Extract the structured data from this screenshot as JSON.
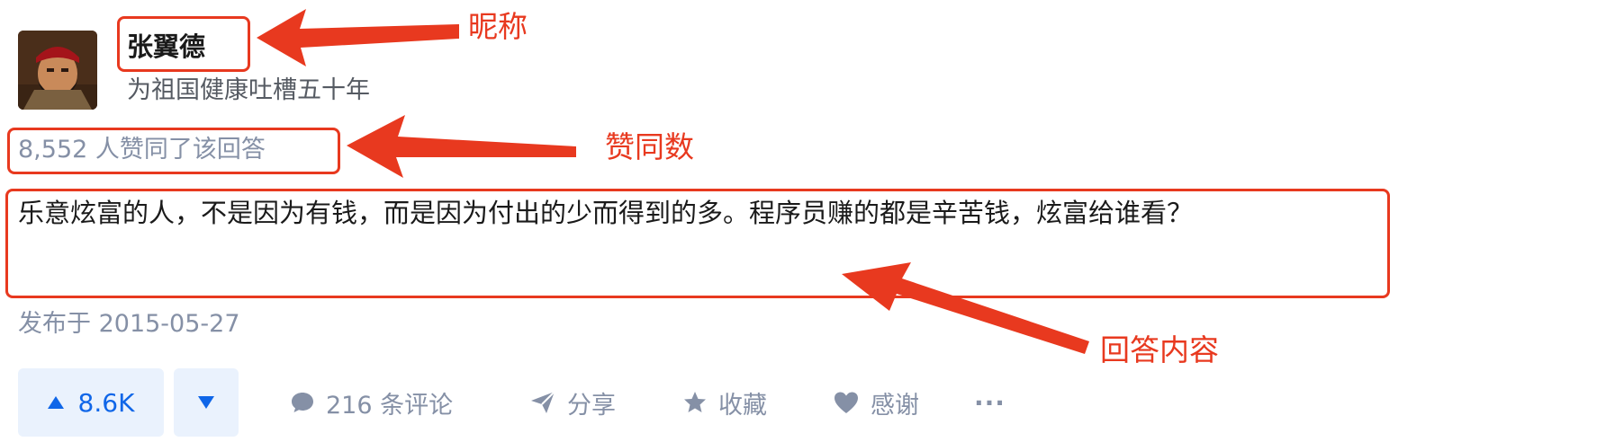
{
  "author": {
    "name": "张翼德",
    "bio": "为祖国健康吐槽五十年",
    "avatar_icon": "avatar-warrior"
  },
  "answer": {
    "vote_summary": "8,552 人赞同了该回答",
    "content": "乐意炫富的人，不是因为有钱，而是因为付出的少而得到的多。程序员赚的都是辛苦钱，炫富给谁看？",
    "publish_time": "发布于 2015-05-27"
  },
  "actions": {
    "upvote_label": "8.6K",
    "comment_label": "216 条评论",
    "share_label": "分享",
    "favorite_label": "收藏",
    "thanks_label": "感谢",
    "more_label": "···"
  },
  "annotations": {
    "nickname": "昵称",
    "votes": "赞同数",
    "content": "回答内容",
    "color": "#e8391f"
  },
  "colors": {
    "accent_blue": "#0f66e8",
    "vote_button_bg": "#eaf2fd",
    "meta_gray": "#8590a6"
  }
}
